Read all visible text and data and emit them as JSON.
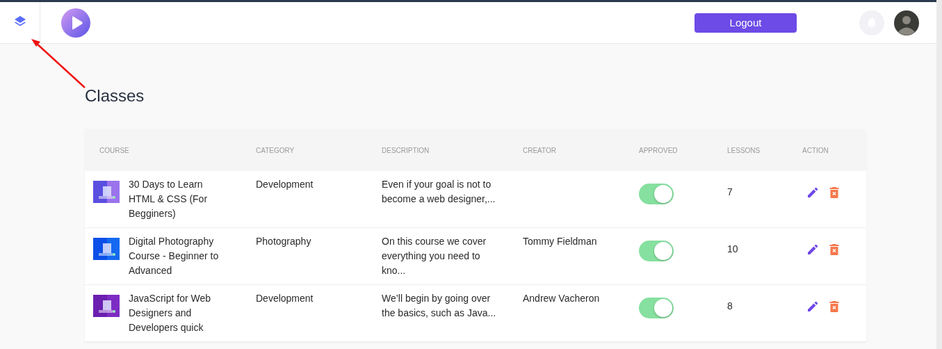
{
  "header": {
    "logout_button": "Logout"
  },
  "page": {
    "title": "Classes"
  },
  "table": {
    "columns": [
      "COURSE",
      "CATEGORY",
      "DESCRIPTION",
      "CREATOR",
      "APPROVED",
      "LESSONS",
      "ACTION"
    ],
    "rows": [
      {
        "course": "30 Days to Learn HTML & CSS (For Begginers)",
        "category": "Development",
        "description": "Even if your goal is not to become a web designer,...",
        "approved": true,
        "lessons": "7"
      },
      {
        "course": "Digital Photography Course - Beginner to Advanced",
        "category": "Photography",
        "description": "On this course we cover everything you need to kno...",
        "creator": "Tommy Fieldman",
        "approved": true,
        "lessons": "10"
      },
      {
        "course": "JavaScript for Web Designers and Developers quick",
        "category": "Development",
        "description": "We’ll begin by going over the basics, such as Java...",
        "creator": "Andrew Vacheron",
        "approved": true,
        "lessons": "8"
      }
    ]
  }
}
